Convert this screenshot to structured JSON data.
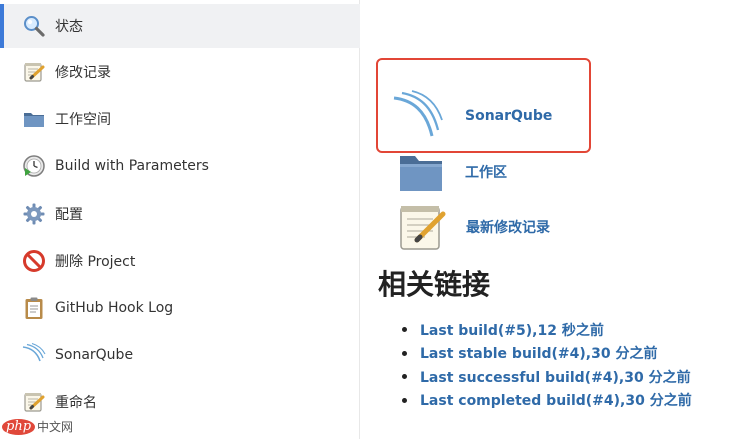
{
  "sidebar": {
    "items": [
      {
        "label": "状态",
        "icon": "magnifier-icon",
        "active": true
      },
      {
        "label": "修改记录",
        "icon": "notepad-icon"
      },
      {
        "label": "工作空间",
        "icon": "folder-icon"
      },
      {
        "label": "Build with Parameters",
        "icon": "clock-play-icon"
      },
      {
        "label": "配置",
        "icon": "gear-icon"
      },
      {
        "label": "删除 Project",
        "icon": "no-entry-icon"
      },
      {
        "label": "GitHub Hook Log",
        "icon": "clipboard-icon"
      },
      {
        "label": "SonarQube",
        "icon": "sonarqube-wave-icon"
      },
      {
        "label": "重命名",
        "icon": "notepad-icon"
      }
    ]
  },
  "main": {
    "top_text": "",
    "sonarqube_label": "SonarQube",
    "workspace_label": "工作区",
    "changes_label": "最新修改记录",
    "related_links_title": "相关链接",
    "related_links": [
      "Last build(#5),12 秒之前",
      "Last stable build(#4),30 分之前",
      "Last successful build(#4),30 分之前",
      "Last completed build(#4),30 分之前"
    ]
  },
  "colors": {
    "link": "#2f6aa8",
    "highlight_border": "#e24636",
    "active_accent": "#3d7ad8"
  },
  "watermark": {
    "logo": "php",
    "text": "中文网"
  }
}
